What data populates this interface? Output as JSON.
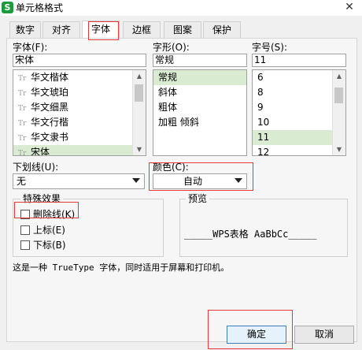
{
  "window": {
    "title": "单元格格式",
    "app_icon": "S",
    "close_glyph": "✕"
  },
  "tabs": [
    {
      "label": "数字"
    },
    {
      "label": "对齐"
    },
    {
      "label": "字体"
    },
    {
      "label": "边框"
    },
    {
      "label": "图案"
    },
    {
      "label": "保护"
    }
  ],
  "font": {
    "label": "字体(F):",
    "value": "宋体",
    "items": [
      "华文楷体",
      "华文琥珀",
      "华文细黑",
      "华文行楷",
      "华文隶书",
      "宋体"
    ],
    "selected": "宋体"
  },
  "style": {
    "label": "字形(O):",
    "value": "常规",
    "items": [
      "常规",
      "斜体",
      "粗体",
      "加粗 倾斜"
    ],
    "selected": "常规"
  },
  "size": {
    "label": "字号(S):",
    "value": "11",
    "items": [
      "6",
      "8",
      "9",
      "10",
      "11",
      "12"
    ],
    "selected": "11"
  },
  "underline": {
    "label": "下划线(U):",
    "value": "无"
  },
  "color": {
    "label": "颜色(C):",
    "value": "自动"
  },
  "effects": {
    "title": "特殊效果",
    "strikethrough": "删除线(K)",
    "superscript": "上标(E)",
    "subscript": "下标(B)"
  },
  "preview": {
    "title": "预览",
    "text": "_____WPS表格  AaBbCc_____"
  },
  "description": "这是一种 TrueType 字体，同时适用于屏幕和打印机。",
  "buttons": {
    "ok": "确定",
    "cancel": "取消"
  },
  "colors": {
    "accent_red": "#e53935",
    "selection": "#d9ebd1",
    "app_green": "#1e9a3c"
  }
}
